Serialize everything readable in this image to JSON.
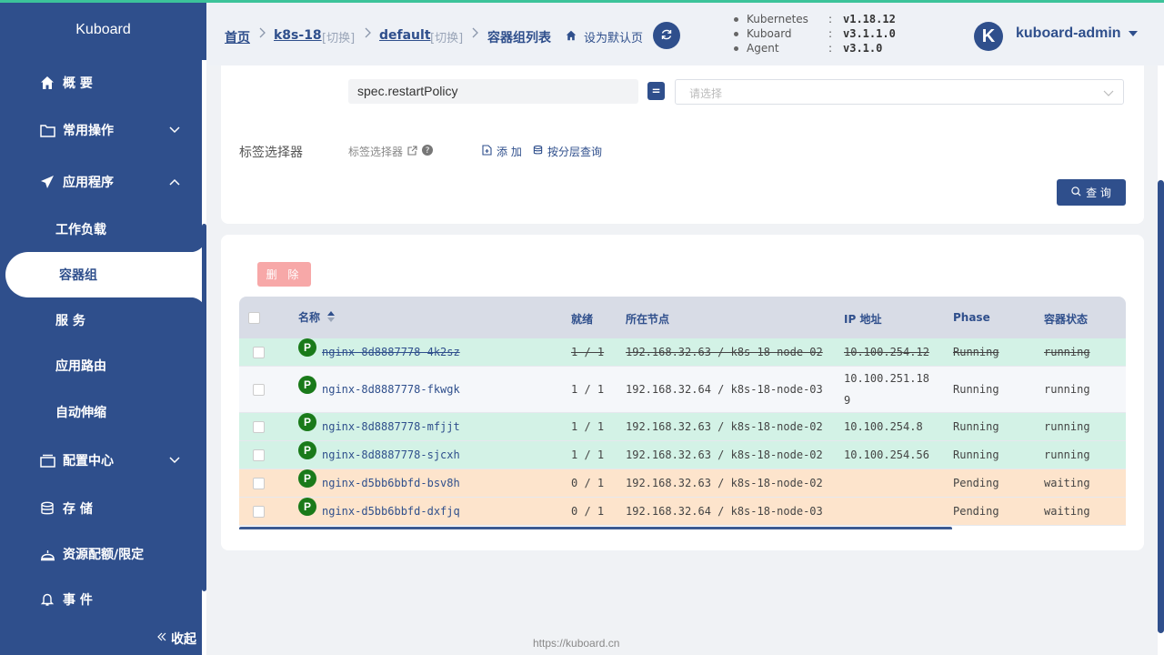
{
  "app": {
    "logo": "Kuboard"
  },
  "sidebar": {
    "items": [
      {
        "label": "概 要",
        "icon": "home-icon"
      },
      {
        "label": "常用操作",
        "icon": "folder-icon"
      },
      {
        "label": "应用程序",
        "icon": "paper-plane-icon"
      },
      {
        "label": "工作负载"
      },
      {
        "label": "容器组"
      },
      {
        "label": "服 务"
      },
      {
        "label": "应用路由"
      },
      {
        "label": "自动伸缩"
      },
      {
        "label": "配置中心",
        "icon": "inbox-icon"
      },
      {
        "label": "存 储",
        "icon": "database-icon"
      },
      {
        "label": "资源配额/限定",
        "icon": "bell-cover-icon"
      },
      {
        "label": "事 件",
        "icon": "bell-icon"
      }
    ],
    "collapse_label": "收起"
  },
  "header": {
    "breadcrumb": {
      "home": "首页",
      "cluster": "k8s-18",
      "switch1": "[切换]",
      "namespace": "default",
      "switch2": "[切换]",
      "current": "容器组列表"
    },
    "set_default": "设为默认页",
    "versions": [
      {
        "name": "Kubernetes",
        "colon": ":",
        "value": "v1.18.12"
      },
      {
        "name": "Kuboard",
        "colon": ":",
        "value": "v3.1.1.0"
      },
      {
        "name": "Agent",
        "colon": ":",
        "value": "v3.1.0"
      }
    ],
    "avatar_letter": "K",
    "user": "kuboard-admin"
  },
  "filter": {
    "field_key": "spec.restartPolicy",
    "operator": "=",
    "select_placeholder": "请选择",
    "label_selector_title": "标签选择器",
    "label_selector_link": "标签选择器",
    "add_label": "添 加",
    "layer_query_label": "按分层查询",
    "query_label": "查 询"
  },
  "table": {
    "delete_label": "删 除",
    "columns": [
      "名称",
      "就绪",
      "所在节点",
      "IP 地址",
      "Phase",
      "容器状态"
    ],
    "rows": [
      {
        "badge": "P",
        "name": "nginx-8d8887778-4k2sz",
        "ready": "1 / 1",
        "node": "192.168.32.63 / k8s-18-node-02",
        "ip": "10.100.254.12",
        "ip2": "",
        "phase": "Running",
        "state": "running",
        "style": "green-strike"
      },
      {
        "badge": "P",
        "name": "nginx-8d8887778-fkwgk",
        "ready": "1 / 1",
        "node": "192.168.32.64 / k8s-18-node-03",
        "ip": "10.100.251.18",
        "ip2": "9",
        "phase": "Running",
        "state": "running",
        "style": "plain"
      },
      {
        "badge": "P",
        "name": "nginx-8d8887778-mfjjt",
        "ready": "1 / 1",
        "node": "192.168.32.63 / k8s-18-node-02",
        "ip": "10.100.254.8",
        "ip2": "",
        "phase": "Running",
        "state": "running",
        "style": "green"
      },
      {
        "badge": "P",
        "name": "nginx-8d8887778-sjcxh",
        "ready": "1 / 1",
        "node": "192.168.32.63 / k8s-18-node-02",
        "ip": "10.100.254.56",
        "ip2": "",
        "phase": "Running",
        "state": "running",
        "style": "green"
      },
      {
        "badge": "P",
        "name": "nginx-d5bb6bbfd-bsv8h",
        "ready": "0 / 1",
        "node": "192.168.32.63 / k8s-18-node-02",
        "ip": "",
        "ip2": "",
        "phase": "Pending",
        "state": "waiting",
        "style": "orange"
      },
      {
        "badge": "P",
        "name": "nginx-d5bb6bbfd-dxfjq",
        "ready": "0 / 1",
        "node": "192.168.32.64 / k8s-18-node-03",
        "ip": "",
        "ip2": "",
        "phase": "Pending",
        "state": "waiting",
        "style": "orange"
      }
    ]
  },
  "footer": {
    "url": "https://kuboard.cn"
  },
  "colors": {
    "brand": "#2f4f8c",
    "green_row": "#d3f2e6",
    "orange_row": "#fde4cc",
    "plain_row": "#f5f7fa"
  }
}
